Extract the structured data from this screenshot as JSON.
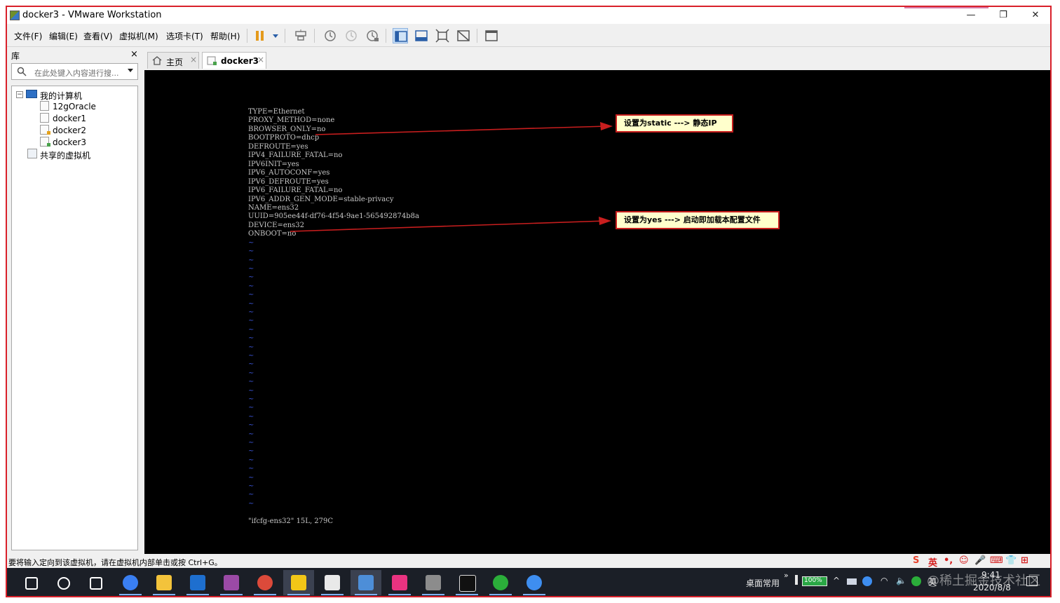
{
  "window": {
    "title": "docker3 - VMware Workstation",
    "controls": {
      "minimize": "—",
      "maximize": "❐",
      "close": "✕"
    }
  },
  "menu": {
    "items": [
      {
        "label": "文件(F)"
      },
      {
        "label": "编辑(E)"
      },
      {
        "label": "查看(V)"
      },
      {
        "label": "虚拟机(M)"
      },
      {
        "label": "选项卡(T)"
      },
      {
        "label": "帮助(H)"
      }
    ]
  },
  "toolbar": {
    "buttons": [
      "pause-icon",
      "dropdown-icon",
      "send-ctrl-alt-del-icon",
      "snapshot-icon",
      "revert-snapshot-icon",
      "snapshot-manager-icon",
      "show-library-icon",
      "thumbnail-bar-icon",
      "fullscreen-icon",
      "unity-icon",
      "console-view-icon"
    ]
  },
  "library": {
    "header": "库",
    "close": "×",
    "search_placeholder": "在此处键入内容进行搜...",
    "tree": {
      "root_expander": "−",
      "root": "我的计算机",
      "vms": [
        "12gOracle",
        "docker1",
        "docker2",
        "docker3"
      ],
      "shared": "共享的虚拟机"
    }
  },
  "tabs": [
    {
      "label": "主页",
      "close": "×"
    },
    {
      "label": "docker3",
      "close": "×"
    }
  ],
  "terminal": {
    "lines": [
      "TYPE=Ethernet",
      "PROXY_METHOD=none",
      "BROWSER_ONLY=no",
      "BOOTPROTO=dhcp",
      "DEFROUTE=yes",
      "IPV4_FAILURE_FATAL=no",
      "IPV6INIT=yes",
      "IPV6_AUTOCONF=yes",
      "IPV6_DEFROUTE=yes",
      "IPV6_FAILURE_FATAL=no",
      "IPV6_ADDR_GEN_MODE=stable-privacy",
      "NAME=ens32",
      "UUID=905ee44f-df76-4f54-9ae1-565492874b8a",
      "DEVICE=ens32",
      "ONBOOT=no"
    ],
    "tilde": "~",
    "tilde_count": 31,
    "status_line": "\"ifcfg-ens32\" 15L, 279C",
    "text_color": "#c8c8c8",
    "tilde_color": "#3b54d6"
  },
  "annotations": [
    {
      "text": "设置为static ---> 静态IP"
    },
    {
      "text": "设置为yes ---> 启动即加载本配置文件"
    }
  ],
  "annotation_color": "#c81e1e",
  "statusbar": {
    "text": "要将输入定向到该虚拟机，请在虚拟机内部单击或按 Ctrl+G。",
    "ime": [
      "S",
      "英",
      "•,",
      "☺",
      "🎤",
      "⌨",
      "👕",
      "⊞"
    ]
  },
  "taskbar": {
    "apps": [
      "windows-start-icon",
      "search-icon",
      "task-view-icon",
      "lark-icon",
      "file-explorer-icon",
      "outlook-icon",
      "winrar-icon",
      "chrome-icon",
      "stock-chart-icon",
      "typora-icon",
      "vmware-icon",
      "intellij-icon",
      "archive-icon",
      "terminal-icon",
      "wechat-icon",
      "feishu-icon"
    ],
    "tray_label": "桌面常用",
    "chevron": "»",
    "battery": "100%",
    "lang": "英",
    "time": "9:41",
    "date": "2020/8/8"
  },
  "watermark": "@稀土掘金技术社区"
}
